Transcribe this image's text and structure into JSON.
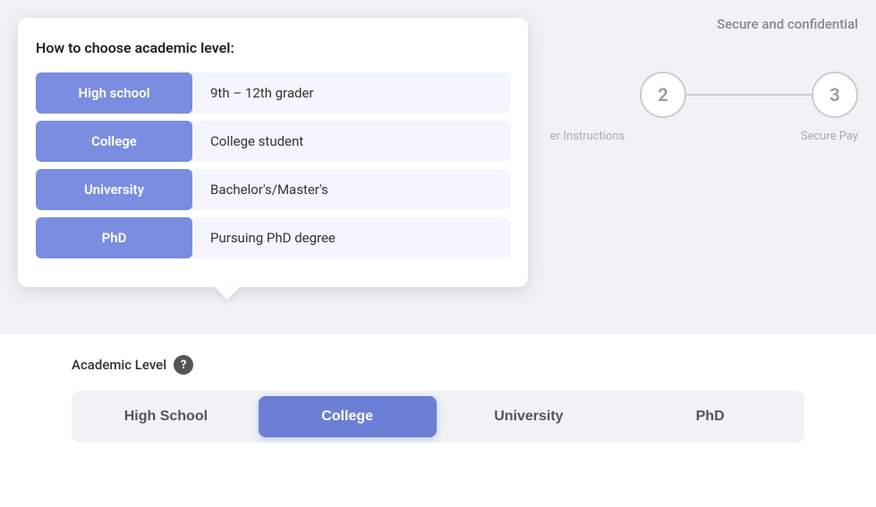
{
  "header": {
    "secure_text": "Secure and confidential"
  },
  "steps": {
    "step2": "2",
    "step3": "3",
    "label2": "er Instructions",
    "label3": "Secure Pay"
  },
  "tooltip": {
    "title": "How to choose academic level:",
    "levels": [
      {
        "badge": "High school",
        "description": "9th – 12th grader"
      },
      {
        "badge": "College",
        "description": "College student"
      },
      {
        "badge": "University",
        "description": "Bachelor's/Master's"
      },
      {
        "badge": "PhD",
        "description": "Pursuing PhD degree"
      }
    ]
  },
  "academic_section": {
    "label": "Academic Level",
    "help_icon": "?",
    "buttons": [
      {
        "label": "High School",
        "active": false
      },
      {
        "label": "College",
        "active": true
      },
      {
        "label": "University",
        "active": false
      },
      {
        "label": "PhD",
        "active": false
      }
    ]
  }
}
